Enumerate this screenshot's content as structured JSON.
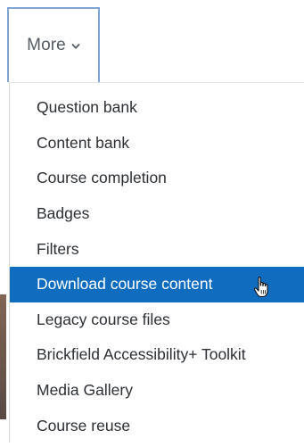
{
  "toggle": {
    "label": "More",
    "icon": "chevron-down-icon"
  },
  "menu": {
    "items": [
      {
        "label": "Question bank",
        "active": false
      },
      {
        "label": "Content bank",
        "active": false
      },
      {
        "label": "Course completion",
        "active": false
      },
      {
        "label": "Badges",
        "active": false
      },
      {
        "label": "Filters",
        "active": false
      },
      {
        "label": "Download course content",
        "active": true
      },
      {
        "label": "Legacy course files",
        "active": false
      },
      {
        "label": "Brickfield Accessibility+ Toolkit",
        "active": false
      },
      {
        "label": "Media Gallery",
        "active": false
      },
      {
        "label": "Course reuse",
        "active": false
      }
    ],
    "active_color": "#0f6cbf",
    "cursor_icon": "hand-pointer-icon"
  }
}
